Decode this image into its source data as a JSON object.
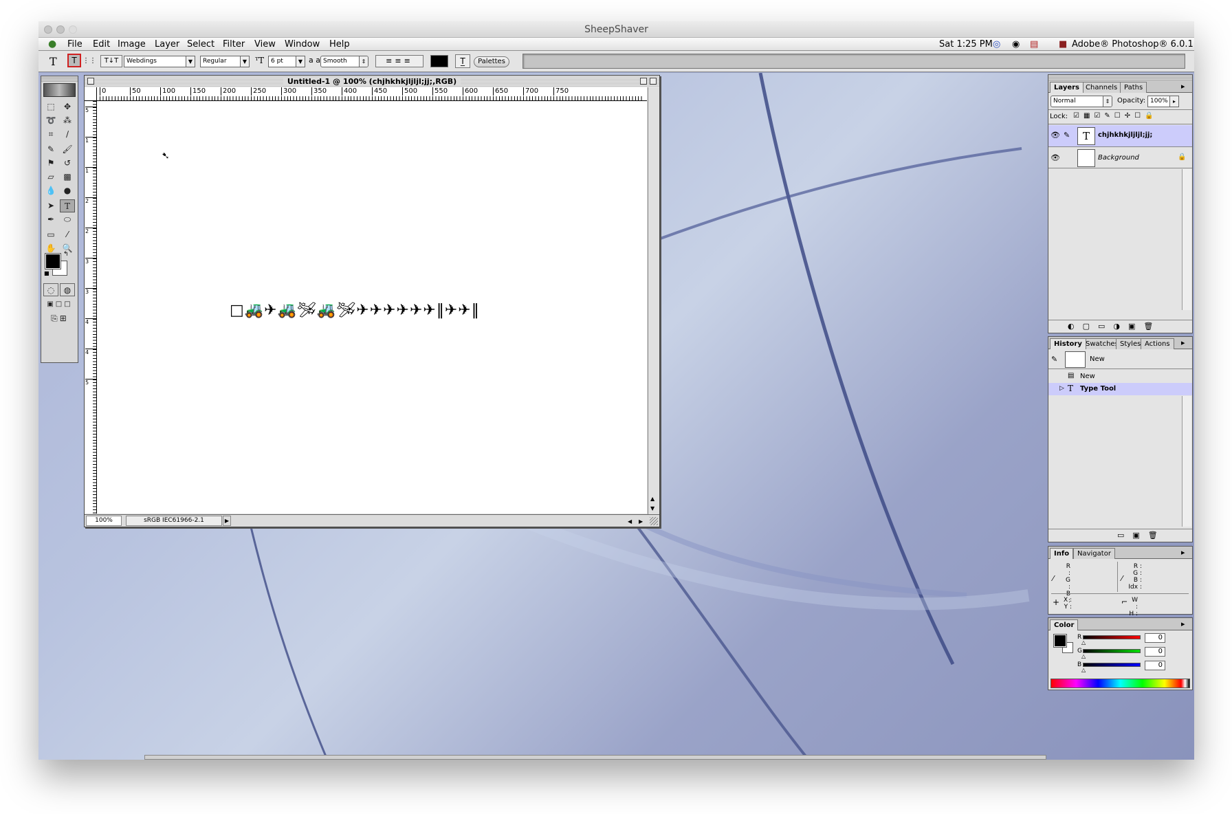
{
  "window": {
    "title": "SheepShaver"
  },
  "menubar": {
    "items": [
      "File",
      "Edit",
      "Image",
      "Layer",
      "Select",
      "Filter",
      "View",
      "Window",
      "Help"
    ],
    "clock": "Sat 1:25 PM",
    "app_name": "Adobe® Photoshop® 6.0.1"
  },
  "options_bar": {
    "tool_icon": "T",
    "font_family": "Webdings",
    "font_style": "Regular",
    "font_size": "6 pt",
    "aa_label": "a a",
    "antialias": "Smooth",
    "palettes_label": "Palettes",
    "text_color": "#000000"
  },
  "document": {
    "title": "Untitled-1 @ 100% (chjhkhkjljljl;jj;,RGB)",
    "zoom": "100%",
    "profile": "sRGB IEC61966-2.1",
    "ruler_h": [
      "0",
      "50",
      "100",
      "150",
      "200",
      "250",
      "300",
      "350",
      "400",
      "450",
      "500",
      "550",
      "600",
      "650",
      "700",
      "750"
    ],
    "ruler_v": [
      "5",
      "1",
      "1",
      "2",
      "2",
      "3",
      "3",
      "4",
      "4",
      "5"
    ],
    "glyph_text": "□🚜✈🚜🛩🚜🛩✈✈✈✈✈✈‖✈✈‖"
  },
  "layers_panel": {
    "tabs": [
      "Layers",
      "Channels",
      "Paths"
    ],
    "blend_mode": "Normal",
    "opacity_label": "Opacity:",
    "opacity": "100%",
    "lock_label": "Lock:",
    "layers": [
      {
        "name": "chjhkhkjljljl;jj;",
        "thumb": "T",
        "selected": true
      },
      {
        "name": "Background",
        "thumb": "",
        "selected": false
      }
    ]
  },
  "history_panel": {
    "tabs": [
      "History",
      "Swatches",
      "Styles",
      "Actions"
    ],
    "snapshot": "New",
    "steps": [
      {
        "name": "New",
        "selected": false
      },
      {
        "name": "Type Tool",
        "selected": true
      }
    ]
  },
  "info_panel": {
    "tabs": [
      "Info",
      "Navigator"
    ],
    "rgb_labels": [
      "R :",
      "G :",
      "B :"
    ],
    "rgb_labels2": [
      "R :",
      "G :",
      "B :",
      "Idx :"
    ],
    "xy_labels": [
      "X :",
      "Y :"
    ],
    "wh_labels": [
      "W :",
      "H :"
    ]
  },
  "color_panel": {
    "tab": "Color",
    "channels": [
      {
        "label": "R",
        "value": "0",
        "color": "#d01010"
      },
      {
        "label": "G",
        "value": "0",
        "color": "#10a020"
      },
      {
        "label": "B",
        "value": "0",
        "color": "#1020c0"
      }
    ]
  },
  "colors": {
    "desktop": "#9aa5c8",
    "selection": "#ccccfb"
  }
}
